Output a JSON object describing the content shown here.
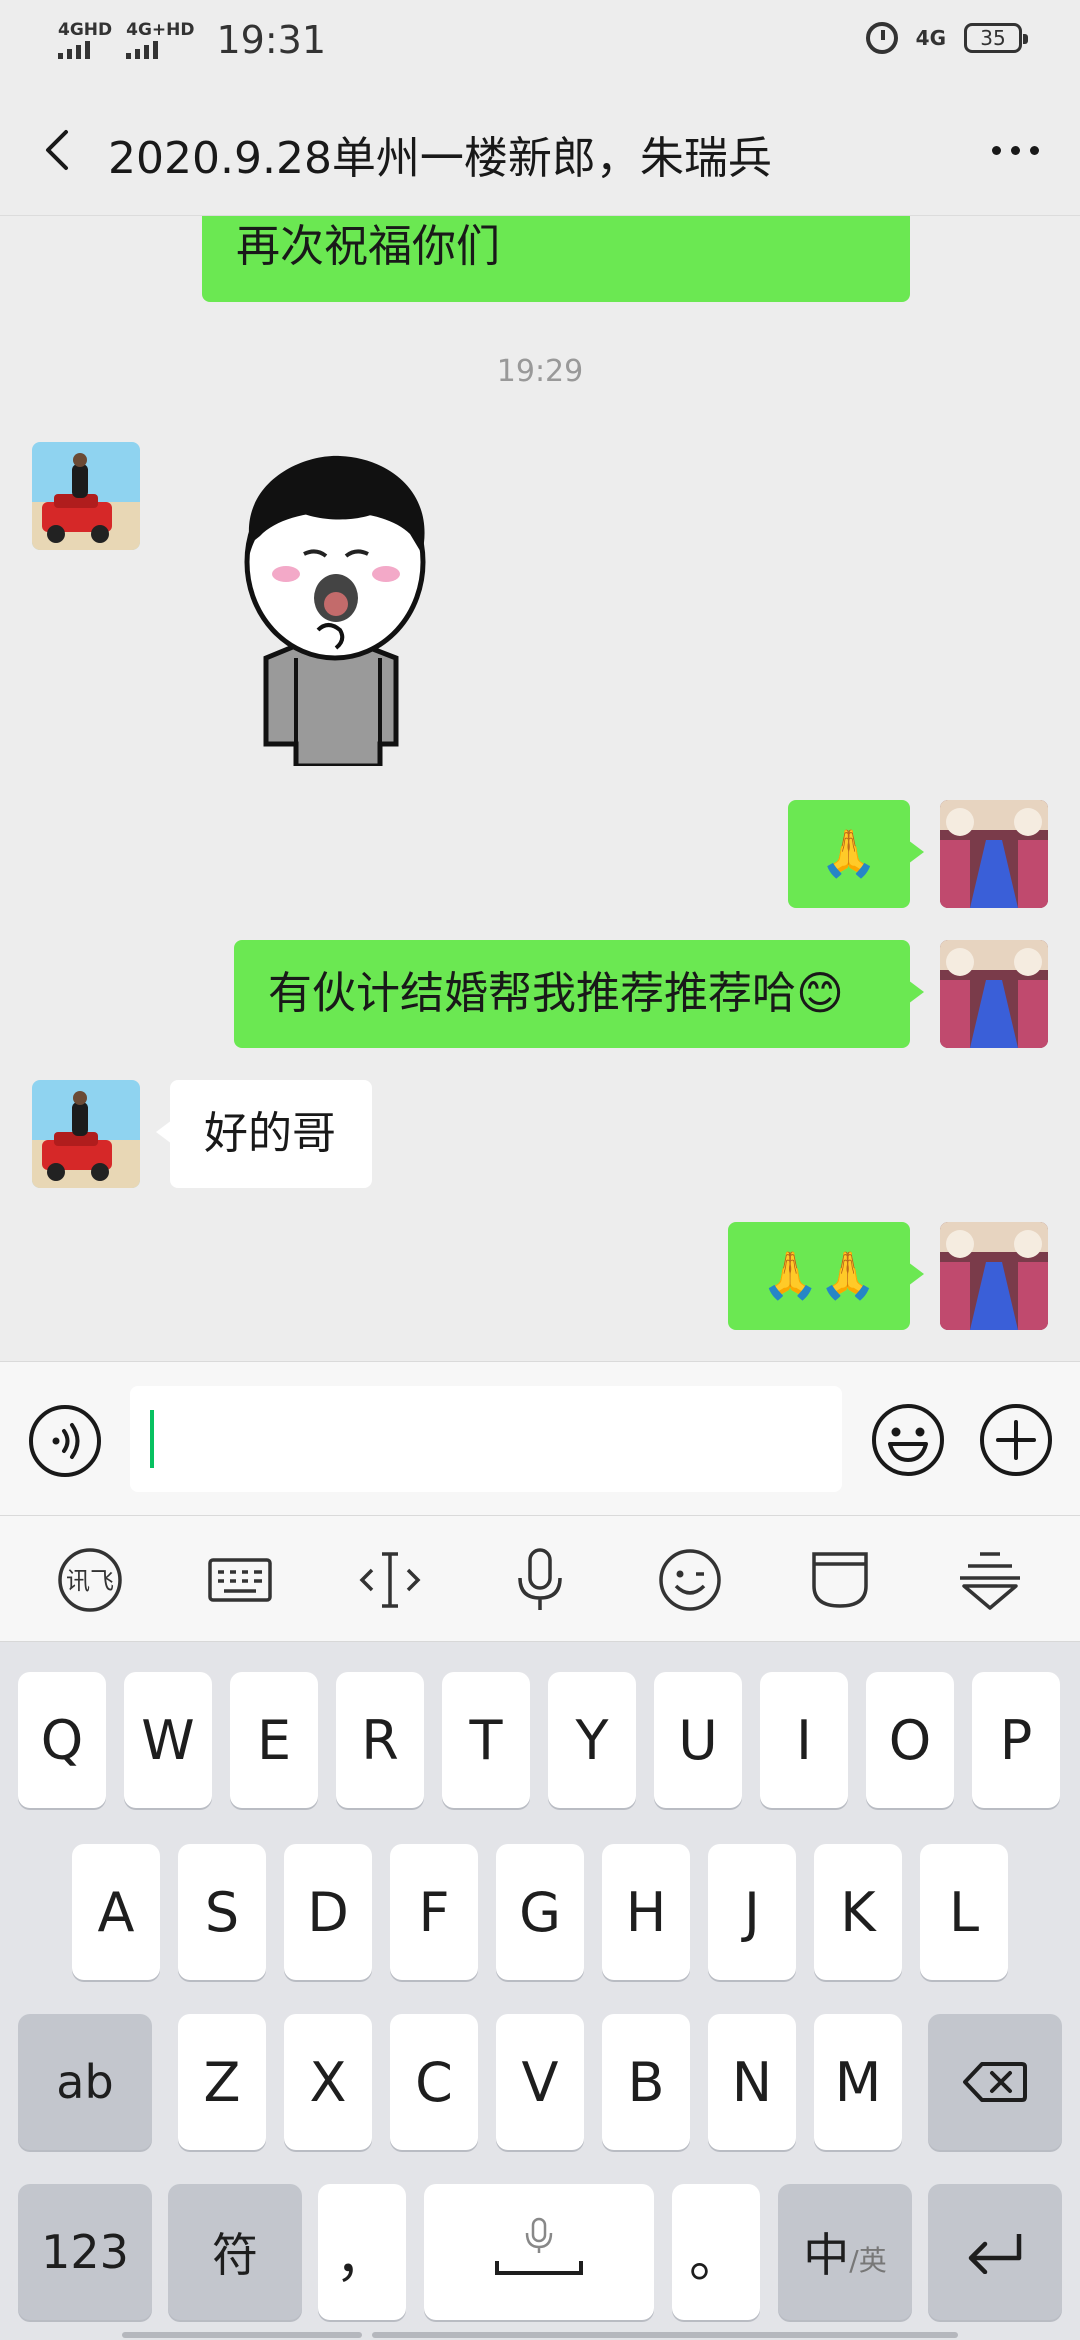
{
  "status_bar": {
    "sim1_label": "4GHD",
    "sim2_label": "4G+HD",
    "time": "19:31",
    "network": "4G",
    "battery": "35",
    "icons": [
      "signal-icon",
      "alarm-icon",
      "battery-icon"
    ]
  },
  "nav": {
    "title": "2020.9.28单州一楼新郎，朱瑞兵",
    "icons": [
      "back-arrow-icon",
      "more-icon"
    ]
  },
  "chat": {
    "messages": [
      {
        "id": "m1",
        "side": "out",
        "text": "再次祝福你们"
      },
      {
        "id": "ts1",
        "type": "timestamp",
        "text": "19:29"
      },
      {
        "id": "m2",
        "side": "in",
        "type": "sticker",
        "sticker": "mushroom-head-sticker"
      },
      {
        "id": "m3",
        "side": "out",
        "text": "🙏"
      },
      {
        "id": "m4",
        "side": "out",
        "text": "有伙计结婚帮我推荐推荐哈",
        "emoji": "😊"
      },
      {
        "id": "m5",
        "side": "in",
        "text": "好的哥"
      },
      {
        "id": "m6",
        "side": "out",
        "text": "🙏🙏"
      }
    ]
  },
  "input_bar": {
    "value": "",
    "icons": [
      "voice-icon",
      "emoji-icon",
      "plus-icon"
    ]
  },
  "ime_toolbar": {
    "icons": [
      "ifly-logo-icon",
      "keyboard-icon",
      "cursor-move-icon",
      "microphone-icon",
      "smiley-icon",
      "clipboard-icon",
      "collapse-keyboard-icon"
    ]
  },
  "keyboard": {
    "row1": [
      "Q",
      "W",
      "E",
      "R",
      "T",
      "Y",
      "U",
      "I",
      "O",
      "P"
    ],
    "row2": [
      "A",
      "S",
      "D",
      "F",
      "G",
      "H",
      "J",
      "K",
      "L"
    ],
    "row3": [
      "Z",
      "X",
      "C",
      "V",
      "B",
      "N",
      "M"
    ],
    "shift_label": "ab",
    "num_label": "123",
    "symbol_label": "符",
    "comma_label": "，",
    "period_label": "。",
    "lang_label_main": "中",
    "lang_label_sub": "/英",
    "icons": [
      "backspace-icon",
      "space-mic-icon",
      "enter-icon"
    ]
  },
  "colors": {
    "outgoing_bubble": "#6be852",
    "incoming_bubble": "#ffffff",
    "chat_bg": "#ededed",
    "caret": "#07c160",
    "keyboard_bg": "#e3e4e8"
  }
}
